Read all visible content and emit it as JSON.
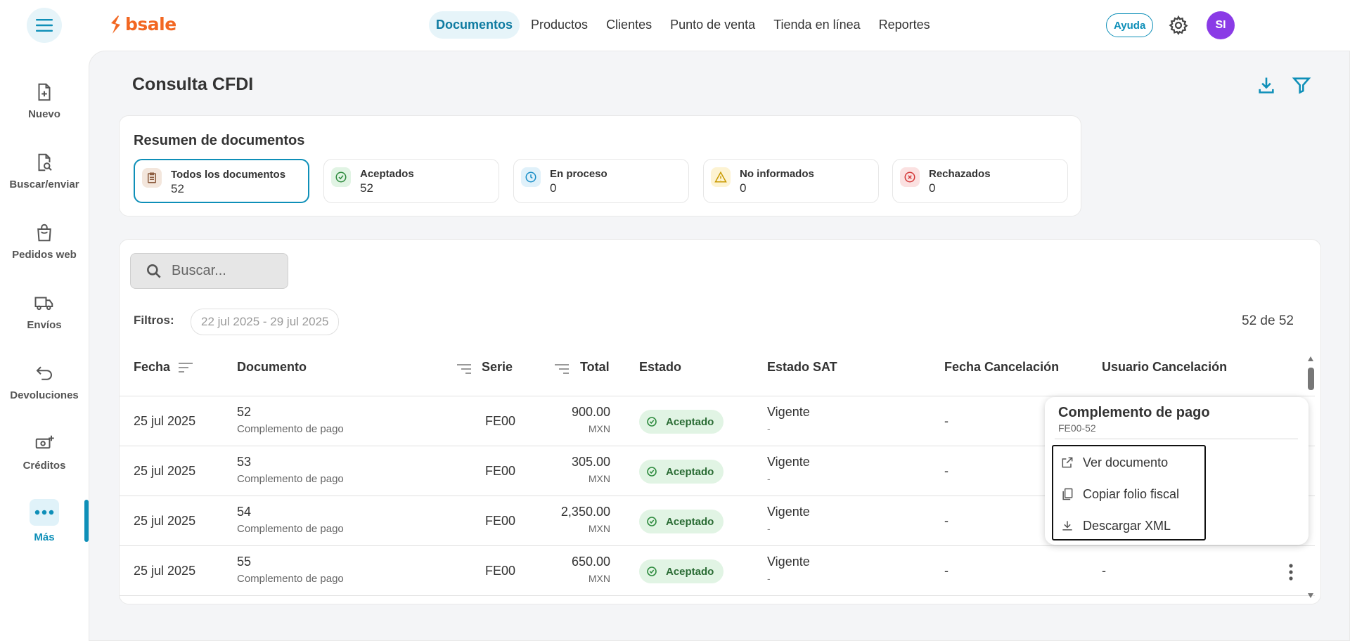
{
  "app": {
    "logo_text": "bsale"
  },
  "nav": [
    {
      "label": "Documentos",
      "active": true
    },
    {
      "label": "Productos"
    },
    {
      "label": "Clientes"
    },
    {
      "label": "Punto de venta"
    },
    {
      "label": "Tienda en línea"
    },
    {
      "label": "Reportes"
    }
  ],
  "header": {
    "help_label": "Ayuda",
    "avatar_initials": "SI"
  },
  "sidebar": {
    "items": [
      {
        "label": "Nuevo",
        "icon": "file-plus-icon"
      },
      {
        "label": "Buscar/enviar",
        "icon": "file-search-icon"
      },
      {
        "label": "Pedidos web",
        "icon": "shopping-bag-icon"
      },
      {
        "label": "Envíos",
        "icon": "truck-icon"
      },
      {
        "label": "Devoluciones",
        "icon": "return-arrow-icon"
      },
      {
        "label": "Créditos",
        "icon": "money-plus-icon"
      },
      {
        "label": "Más",
        "icon": "more-dots-icon",
        "active": true
      }
    ]
  },
  "page": {
    "title": "Consulta CFDI"
  },
  "summary": {
    "title": "Resumen de documentos",
    "stats": [
      {
        "label": "Todos los documentos",
        "value": "52",
        "icon": "clipboard-icon",
        "color": "#8b5a3c",
        "bg": "#f3e6dc",
        "active": true
      },
      {
        "label": "Aceptados",
        "value": "52",
        "icon": "check-circle-icon",
        "color": "#2e8b3e",
        "bg": "#e1f4e4"
      },
      {
        "label": "En proceso",
        "value": "0",
        "icon": "clock-icon",
        "color": "#1a8fc8",
        "bg": "#e0f1fa"
      },
      {
        "label": "No informados",
        "value": "0",
        "icon": "warning-icon",
        "color": "#c99a00",
        "bg": "#fdf3d2"
      },
      {
        "label": "Rechazados",
        "value": "0",
        "icon": "x-circle-icon",
        "color": "#d43a3a",
        "bg": "#fbe1e1"
      }
    ]
  },
  "table": {
    "search_placeholder": "Buscar...",
    "filters_label": "Filtros:",
    "filter_chip": "22 jul 2025 - 29 jul 2025",
    "count": "52 de 52",
    "headers": {
      "fecha": "Fecha",
      "documento": "Documento",
      "serie": "Serie",
      "total": "Total",
      "estado": "Estado",
      "estado_sat": "Estado SAT",
      "fecha_cancelacion": "Fecha Cancelación",
      "usuario_cancelacion": "Usuario Cancelación"
    },
    "rows": [
      {
        "fecha": "25 jul 2025",
        "doc_num": "52",
        "doc_type": "Complemento de pago",
        "serie": "FE00",
        "total": "900.00",
        "currency": "MXN",
        "estado": "Aceptado",
        "sat": "Vigente",
        "sat_sub": "-",
        "fecha_cancel": "-",
        "usuario_cancel": ""
      },
      {
        "fecha": "25 jul 2025",
        "doc_num": "53",
        "doc_type": "Complemento de pago",
        "serie": "FE00",
        "total": "305.00",
        "currency": "MXN",
        "estado": "Aceptado",
        "sat": "Vigente",
        "sat_sub": "-",
        "fecha_cancel": "-",
        "usuario_cancel": ""
      },
      {
        "fecha": "25 jul 2025",
        "doc_num": "54",
        "doc_type": "Complemento de pago",
        "serie": "FE00",
        "total": "2,350.00",
        "currency": "MXN",
        "estado": "Aceptado",
        "sat": "Vigente",
        "sat_sub": "-",
        "fecha_cancel": "-",
        "usuario_cancel": ""
      },
      {
        "fecha": "25 jul 2025",
        "doc_num": "55",
        "doc_type": "Complemento de pago",
        "serie": "FE00",
        "total": "650.00",
        "currency": "MXN",
        "estado": "Aceptado",
        "sat": "Vigente",
        "sat_sub": "-",
        "fecha_cancel": "-",
        "usuario_cancel": "-"
      }
    ]
  },
  "popup": {
    "title": "Complemento de pago",
    "subtitle": "FE00-52",
    "items": [
      {
        "label": "Ver documento",
        "icon": "external-link-icon"
      },
      {
        "label": "Copiar folio fiscal",
        "icon": "copy-icon"
      },
      {
        "label": "Descargar XML",
        "icon": "download-icon"
      }
    ]
  }
}
